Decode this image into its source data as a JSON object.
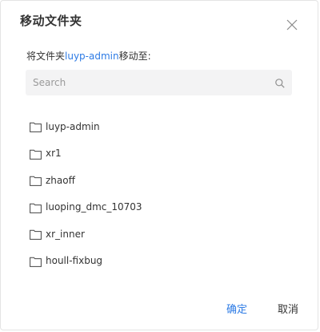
{
  "dialog": {
    "title": "移动文件夹",
    "instruction_prefix": "将文件夹",
    "instruction_folder": "luyp-admin",
    "instruction_suffix": "移动至:",
    "close_icon": "close-icon"
  },
  "search": {
    "placeholder": "Search",
    "value": "",
    "icon": "search-icon"
  },
  "folders": [
    {
      "label": "luyp-admin",
      "icon": "folder-icon"
    },
    {
      "label": "xr1",
      "icon": "folder-icon"
    },
    {
      "label": "zhaoff",
      "icon": "folder-icon"
    },
    {
      "label": "luoping_dmc_10703",
      "icon": "folder-icon"
    },
    {
      "label": "xr_inner",
      "icon": "folder-icon"
    },
    {
      "label": "houll-fixbug",
      "icon": "folder-icon"
    }
  ],
  "buttons": {
    "confirm": "确定",
    "cancel": "取消"
  },
  "colors": {
    "accent": "#2d7be5",
    "text": "#333333",
    "search_bg": "#f3f3f4"
  }
}
